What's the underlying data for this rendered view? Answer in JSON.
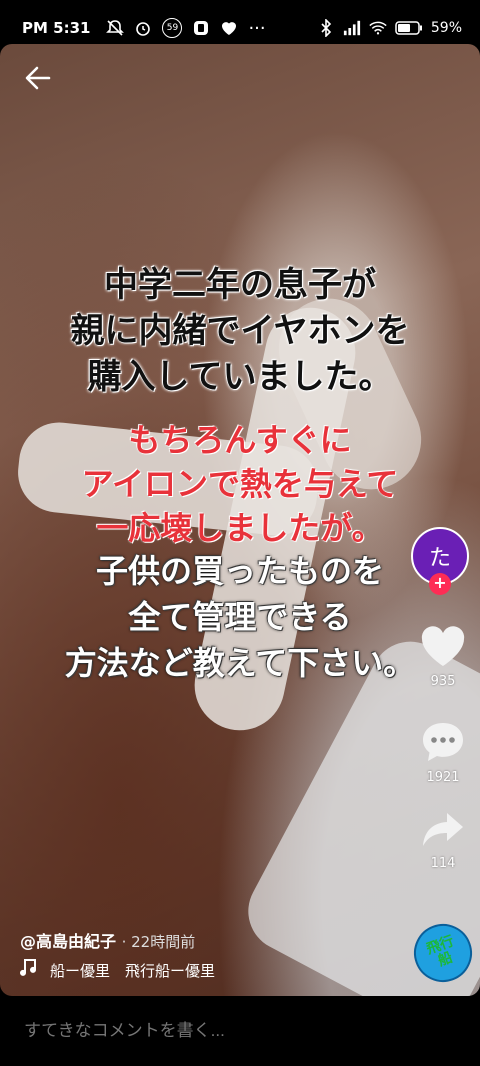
{
  "status_bar": {
    "time": "PM 5:31",
    "notification_badge": "59",
    "battery_percent": "59%",
    "dots": "···"
  },
  "overlay": {
    "black_lines": [
      "中学二年の息子が",
      "親に内緒でイヤホンを",
      "購入していました。"
    ],
    "red_lines": [
      "もちろんすぐに",
      "アイロンで熱を与えて",
      "一応壊しましたが。"
    ],
    "white_lines": [
      "子供の買ったものを",
      "全て管理できる",
      "方法など教えて下さい。"
    ]
  },
  "creator": {
    "avatar_letter": "た",
    "follow_symbol": "+",
    "handle": "@高島由紀子",
    "posted": "· 22時間前"
  },
  "actions": {
    "likes": "935",
    "comments": "1921",
    "shares": "114"
  },
  "music": {
    "text": "船ー優里　飛行船ー優里",
    "disc_label": "飛行船"
  },
  "comment_bar": {
    "placeholder": "すてきなコメントを書く..."
  },
  "colors": {
    "avatar_bg": "#6a1fb5",
    "follow_plus": "#fe2c55",
    "red_text": "#e8323a",
    "disc_bg": "#1fa0e0"
  }
}
